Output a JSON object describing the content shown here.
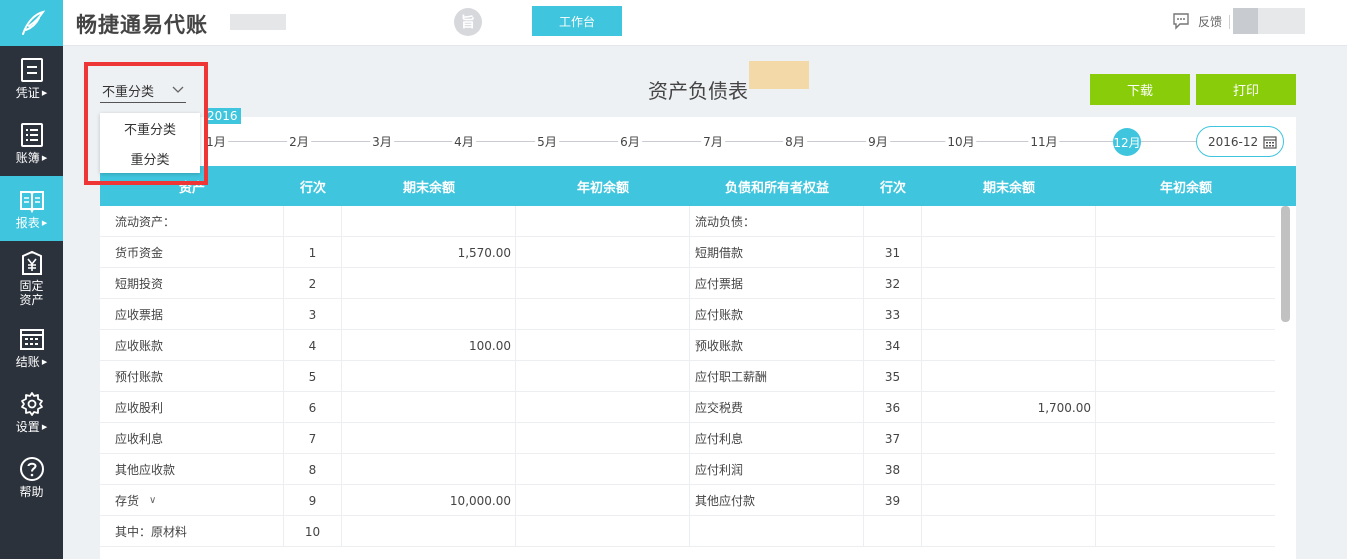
{
  "app": {
    "brand": "畅捷通易代账",
    "workbench_label": "工作台",
    "circle_glyph": "旨"
  },
  "header": {
    "feedback_label": "反馈"
  },
  "sidebar": {
    "items": [
      {
        "label": "凭证",
        "icon": "voucher-icon"
      },
      {
        "label": "账簿",
        "icon": "ledger-icon"
      },
      {
        "label": "报表",
        "icon": "report-icon",
        "active": true
      },
      {
        "label1": "固定",
        "label2": "资产",
        "icon": "yen-icon"
      },
      {
        "label": "结账",
        "icon": "calendar-grid-icon"
      },
      {
        "label": "设置",
        "icon": "gear-icon"
      },
      {
        "label": "帮助",
        "icon": "help-icon"
      }
    ]
  },
  "report": {
    "title": "资产负债表",
    "download_label": "下载",
    "print_label": "打印",
    "classify_select": {
      "value": "不重分类",
      "options": [
        "不重分类",
        "重分类"
      ]
    }
  },
  "timeline": {
    "year": "2016",
    "months": [
      "1月",
      "2月",
      "3月",
      "4月",
      "5月",
      "6月",
      "7月",
      "8月",
      "9月",
      "10月",
      "11月",
      "12月"
    ],
    "active_month": "12月",
    "date_value": "2016-12"
  },
  "table": {
    "headers": [
      "资产",
      "行次",
      "期末余额",
      "年初余额",
      "负债和所有者权益",
      "行次",
      "期末余额",
      "年初余额"
    ],
    "rows": [
      [
        "流动资产：",
        "",
        "",
        "",
        "流动负债：",
        "",
        "",
        ""
      ],
      [
        "货币资金",
        "1",
        "1,570.00",
        "",
        "短期借款",
        "31",
        "",
        ""
      ],
      [
        "短期投资",
        "2",
        "",
        "",
        "应付票据",
        "32",
        "",
        ""
      ],
      [
        "应收票据",
        "3",
        "",
        "",
        "应付账款",
        "33",
        "",
        ""
      ],
      [
        "应收账款",
        "4",
        "100.00",
        "",
        "预收账款",
        "34",
        "",
        ""
      ],
      [
        "预付账款",
        "5",
        "",
        "",
        "应付职工薪酬",
        "35",
        "",
        ""
      ],
      [
        "应收股利",
        "6",
        "",
        "",
        "应交税费",
        "36",
        "1,700.00",
        ""
      ],
      [
        "应收利息",
        "7",
        "",
        "",
        "应付利息",
        "37",
        "",
        ""
      ],
      [
        "其他应收款",
        "8",
        "",
        "",
        "应付利润",
        "38",
        "",
        ""
      ],
      [
        "存货",
        "9",
        "10,000.00",
        "",
        "其他应付款",
        "39",
        "",
        ""
      ],
      [
        "其中：原材料",
        "10",
        "",
        "",
        "",
        "",
        "",
        ""
      ]
    ]
  },
  "colors": {
    "accent": "#3fc5dd",
    "green": "#88cc0a",
    "highlight": "#ee3636",
    "sidebar": "#2c323c"
  }
}
